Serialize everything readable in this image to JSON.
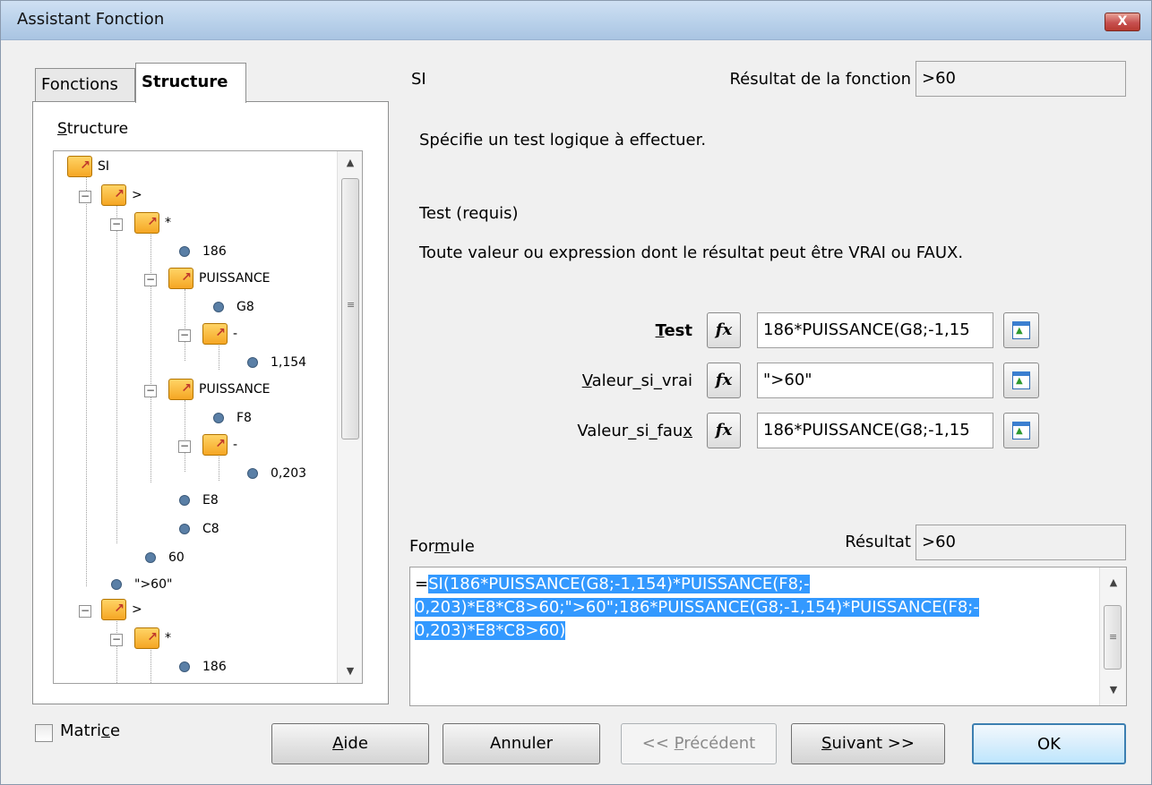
{
  "window": {
    "title": "Assistant Fonction",
    "close_label": "X"
  },
  "tabs": [
    {
      "label": "Fonctions",
      "active": false
    },
    {
      "label": "Structure",
      "active": true
    }
  ],
  "structure": {
    "label": "Structure",
    "tree": [
      {
        "text": "SI",
        "kind": "folder"
      },
      {
        "text": ">",
        "kind": "folder"
      },
      {
        "text": "*",
        "kind": "folder"
      },
      {
        "text": "186",
        "kind": "leaf"
      },
      {
        "text": "PUISSANCE",
        "kind": "folder"
      },
      {
        "text": "G8",
        "kind": "leaf"
      },
      {
        "text": "-",
        "kind": "folder"
      },
      {
        "text": "1,154",
        "kind": "leaf"
      },
      {
        "text": "PUISSANCE",
        "kind": "folder"
      },
      {
        "text": "F8",
        "kind": "leaf"
      },
      {
        "text": "-",
        "kind": "folder"
      },
      {
        "text": "0,203",
        "kind": "leaf"
      },
      {
        "text": "E8",
        "kind": "leaf"
      },
      {
        "text": "C8",
        "kind": "leaf"
      },
      {
        "text": "60",
        "kind": "leaf"
      },
      {
        "text": "\">60\"",
        "kind": "leaf"
      },
      {
        "text": ">",
        "kind": "folder"
      },
      {
        "text": "*",
        "kind": "folder"
      },
      {
        "text": "186",
        "kind": "leaf"
      }
    ]
  },
  "function": {
    "name": "SI",
    "result_label": "Résultat de la fonction",
    "result_value": ">60",
    "description": "Spécifie un test logique à effectuer.",
    "param_title": "Test (requis)",
    "param_description": "Toute valeur ou expression dont le résultat peut être VRAI ou FAUX."
  },
  "arguments": [
    {
      "label": "Test",
      "value": "186*PUISSANCE(G8;-1,15"
    },
    {
      "label": "Valeur_si_vrai",
      "value": "\">60\""
    },
    {
      "label": "Valeur_si_faux",
      "value": "186*PUISSANCE(G8;-1,15"
    }
  ],
  "fx_label": "fx",
  "formula": {
    "label": "Formule",
    "result_label": "Résultat",
    "result_value": ">60",
    "prefix": "=",
    "lines": [
      "SI(186*PUISSANCE(G8;-1,154)*PUISSANCE(F8;-",
      "0,203)*E8*C8>60;\">60\";186*PUISSANCE(G8;-1,154)*PUISSANCE(F8;-",
      "0,203)*E8*C8>60)"
    ]
  },
  "matrix": {
    "label": "Matrice",
    "checked": false
  },
  "buttons": {
    "help": "Aide",
    "cancel": "Annuler",
    "previous": "<< Précédent",
    "next": "Suivant >>",
    "ok": "OK"
  }
}
